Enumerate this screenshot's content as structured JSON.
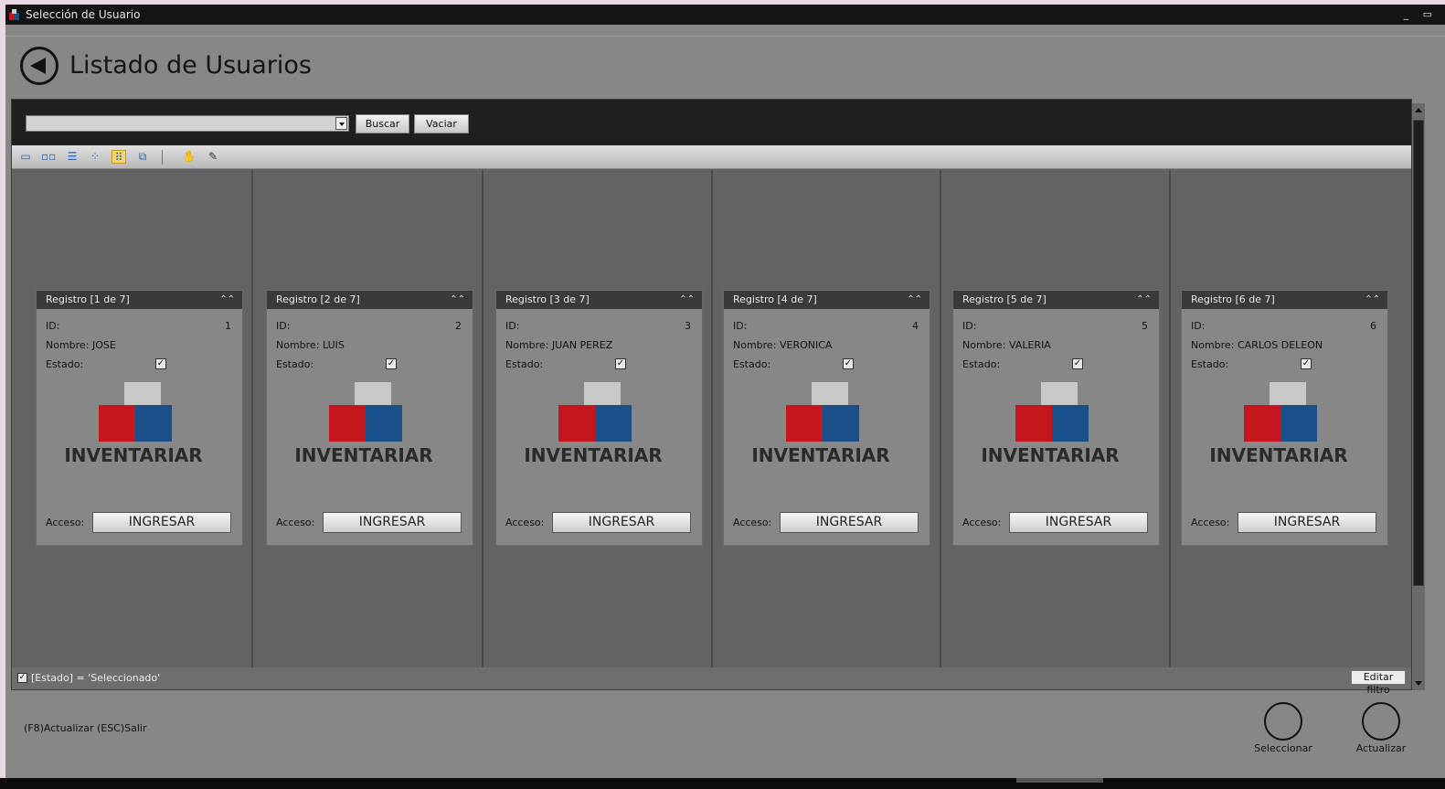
{
  "window": {
    "title": "Selección de Usuario",
    "controls": "_ ▭"
  },
  "page": {
    "heading": "Listado de Usuarios"
  },
  "search": {
    "value": "",
    "buscar_label": "Buscar",
    "vaciar_label": "Vaciar"
  },
  "toolbar": {
    "icons": [
      "single-card-view-icon",
      "two-cards-view-icon",
      "vertical-view-icon",
      "multi-cards-view-icon",
      "grid-cards-view-icon",
      "carousel-view-icon",
      "pan-hand-icon",
      "customize-icon"
    ]
  },
  "cards": [
    {
      "header": "Registro [1 de 7]",
      "id_label": "ID:",
      "id": "1",
      "nombre_label": "Nombre:",
      "nombre": "JOSE",
      "estado_label": "Estado:",
      "estado": true,
      "acceso_label": "Acceso:",
      "button": "INGRESAR",
      "logo_text": "INVENTARIAR"
    },
    {
      "header": "Registro [2 de 7]",
      "id_label": "ID:",
      "id": "2",
      "nombre_label": "Nombre:",
      "nombre": "LUIS",
      "estado_label": "Estado:",
      "estado": true,
      "acceso_label": "Acceso:",
      "button": "INGRESAR",
      "logo_text": "INVENTARIAR"
    },
    {
      "header": "Registro [3 de 7]",
      "id_label": "ID:",
      "id": "3",
      "nombre_label": "Nombre:",
      "nombre": "JUAN PEREZ",
      "estado_label": "Estado:",
      "estado": true,
      "acceso_label": "Acceso:",
      "button": "INGRESAR",
      "logo_text": "INVENTARIAR"
    },
    {
      "header": "Registro [4 de 7]",
      "id_label": "ID:",
      "id": "4",
      "nombre_label": "Nombre:",
      "nombre": "VERONICA",
      "estado_label": "Estado:",
      "estado": true,
      "acceso_label": "Acceso:",
      "button": "INGRESAR",
      "logo_text": "INVENTARIAR"
    },
    {
      "header": "Registro [5 de 7]",
      "id_label": "ID:",
      "id": "5",
      "nombre_label": "Nombre:",
      "nombre": "VALERIA",
      "estado_label": "Estado:",
      "estado": true,
      "acceso_label": "Acceso:",
      "button": "INGRESAR",
      "logo_text": "INVENTARIAR"
    },
    {
      "header": "Registro [6 de 7]",
      "id_label": "ID:",
      "id": "6",
      "nombre_label": "Nombre:",
      "nombre": "CARLOS DELEON",
      "estado_label": "Estado:",
      "estado": true,
      "acceso_label": "Acceso:",
      "button": "INGRESAR",
      "logo_text": "INVENTARIAR"
    }
  ],
  "filter": {
    "text": "[Estado] = 'Seleccionado'",
    "edit_label": "Editar filtro"
  },
  "footer": {
    "hint": "(F8)Actualizar (ESC)Salir",
    "seleccionar_label": "Seleccionar",
    "actualizar_label": "Actualizar"
  },
  "colors": {
    "logo_red": "#c4161c",
    "logo_blue": "#1b4f8a",
    "logo_gray": "#c8c8c8"
  }
}
